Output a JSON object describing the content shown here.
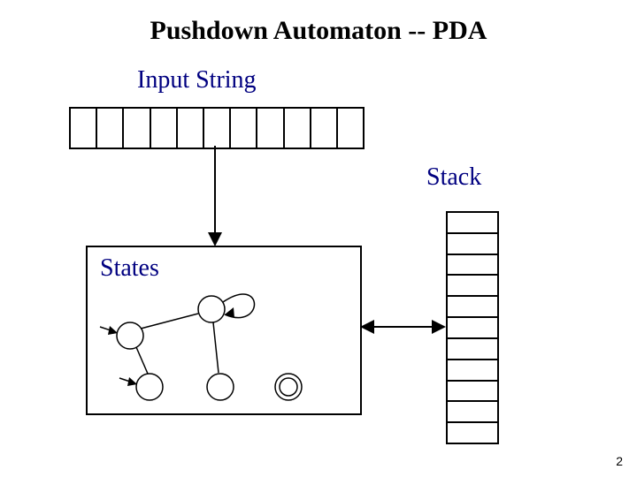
{
  "title": "Pushdown Automaton -- PDA",
  "labels": {
    "input": "Input String",
    "stack": "Stack",
    "states": "States"
  },
  "input_tape_cells": 11,
  "stack_cells": 11,
  "page_number": "2"
}
